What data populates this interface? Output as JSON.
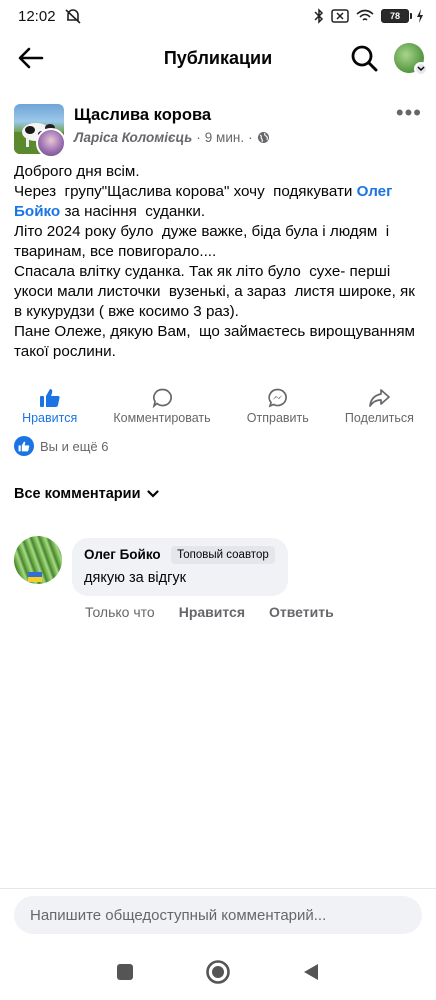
{
  "status_bar": {
    "time": "12:02",
    "battery": "78"
  },
  "header": {
    "title": "Публикации"
  },
  "post": {
    "group_name": "Щаслива корова",
    "author": "Ларіса Коломієць",
    "time": "9 мин.",
    "separator": "·",
    "text_part1": "Доброго дня всім.\nЧерез  групу\"Щаслива корова\" хочу  подякувати ",
    "mention": "Олег Бойко",
    "text_part2": " за насіння  суданки.\nЛіто 2024 року було  дуже важке, біда була і людям  і тваринам, все повигорало....\nСпасала влітку суданка. Так як літо було  сухе- перші укоси мали листочки  вузенькі, а зараз  листя широке, як в кукурудзи ( вже косимо 3 раз).\nПане Олеже, дякую Вам,  що займаєтесь вирощуванням такої рослини."
  },
  "actions": {
    "like": "Нравится",
    "comment": "Комментировать",
    "send": "Отправить",
    "share": "Поделиться"
  },
  "reactions": {
    "text": "Вы и ещё 6"
  },
  "comments_filter": "Все комментарии",
  "comment": {
    "author": "Олег Бойко",
    "badge": "Топовый соавтор",
    "text": "дякую за відгук",
    "time": "Только что",
    "like": "Нравится",
    "reply": "Ответить"
  },
  "input": {
    "placeholder": "Напишите общедоступный комментарий..."
  },
  "colors": {
    "accent": "#1b74e4",
    "secondary_text": "#65676b",
    "bubble": "#f0f2f5"
  }
}
